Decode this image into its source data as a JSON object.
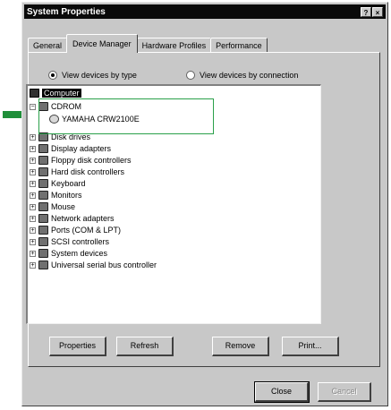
{
  "window": {
    "title": "System Properties",
    "help_btn": "?",
    "close_btn": "×"
  },
  "tabs": [
    {
      "label": "General",
      "active": false
    },
    {
      "label": "Device Manager",
      "active": true
    },
    {
      "label": "Hardware Profiles",
      "active": false
    },
    {
      "label": "Performance",
      "active": false
    }
  ],
  "view_options": {
    "by_type": {
      "label": "View devices by type",
      "selected": true
    },
    "by_connection": {
      "label": "View devices by connection",
      "selected": false
    }
  },
  "tree": {
    "root": "Computer",
    "cdrom": {
      "label": "CDROM",
      "expanded": true,
      "child": "YAMAHA CRW2100E"
    },
    "items": [
      {
        "label": "Disk drives",
        "icon": "disk-drive-icon"
      },
      {
        "label": "Display adapters",
        "icon": "display-adapter-icon"
      },
      {
        "label": "Floppy disk controllers",
        "icon": "floppy-controller-icon"
      },
      {
        "label": "Hard disk controllers",
        "icon": "hard-disk-controller-icon"
      },
      {
        "label": "Keyboard",
        "icon": "keyboard-icon"
      },
      {
        "label": "Monitors",
        "icon": "monitor-icon"
      },
      {
        "label": "Mouse",
        "icon": "mouse-icon"
      },
      {
        "label": "Network adapters",
        "icon": "network-adapter-icon"
      },
      {
        "label": "Ports (COM & LPT)",
        "icon": "ports-icon"
      },
      {
        "label": "SCSI controllers",
        "icon": "scsi-controller-icon"
      },
      {
        "label": "System devices",
        "icon": "system-devices-icon"
      },
      {
        "label": "Universal serial bus controller",
        "icon": "usb-icon"
      }
    ]
  },
  "buttons": {
    "properties": "Properties",
    "refresh": "Refresh",
    "remove": "Remove",
    "print": "Print...",
    "close": "Close",
    "cancel": "Cancel"
  },
  "colors": {
    "highlight_box": "#2aa04a",
    "arrow": "#1f8f3a"
  }
}
